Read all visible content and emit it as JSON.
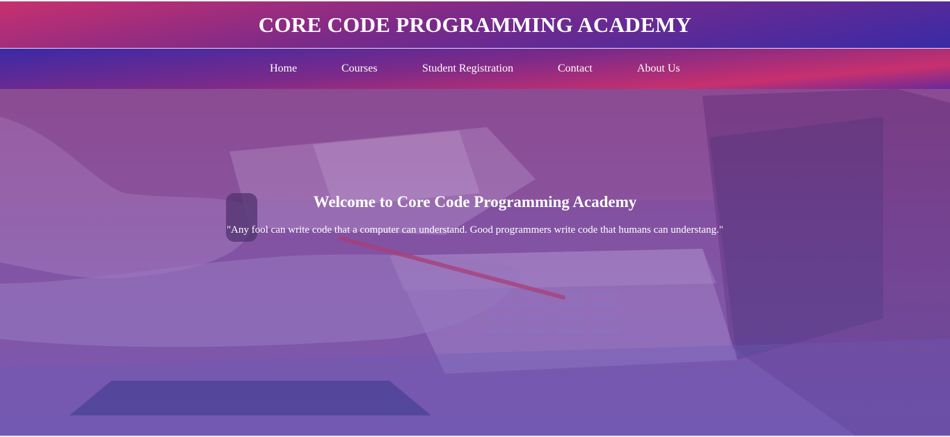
{
  "header": {
    "title": "CORE CODE PROGRAMMING ACADEMY"
  },
  "nav": {
    "items": [
      {
        "label": "Home"
      },
      {
        "label": "Courses"
      },
      {
        "label": "Student Registration"
      },
      {
        "label": "Contact"
      },
      {
        "label": "About Us"
      }
    ]
  },
  "hero": {
    "title": "Welcome to Core Code Programming Academy",
    "quote": "\"Any fool can write code that a computer can understand. Good programmers write code that humans can understang.\"",
    "image_subject": "laptop-desk-photo"
  },
  "colors": {
    "header_gradient_start": "#c8306e",
    "header_gradient_end": "#3a2aa6",
    "hero_tint": "#7a5aa8",
    "text": "#ffffff"
  }
}
